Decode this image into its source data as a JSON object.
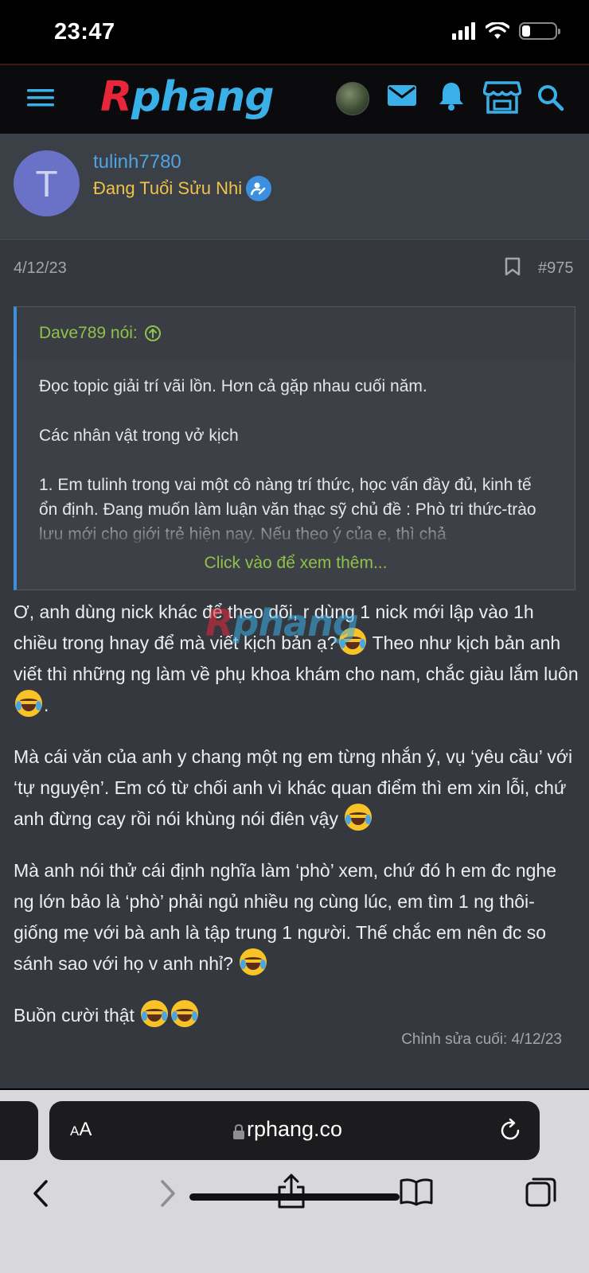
{
  "status": {
    "time": "23:47"
  },
  "header": {
    "logo_first": "R",
    "logo_rest": "phang",
    "icons": [
      "menu-icon",
      "mail-icon",
      "bell-icon",
      "store-icon",
      "search-icon"
    ]
  },
  "user": {
    "initial": "T",
    "name": "tulinh7780",
    "title": "Đang Tuổi Sửu Nhi"
  },
  "post": {
    "date": "4/12/23",
    "number": "#975",
    "quote": {
      "author": "Dave789 nói:",
      "paragraphs": [
        "Đọc topic giải trí vãi lồn. Hơn cả gặp nhau cuối năm.",
        "Các nhân vật trong vở kịch",
        "1. Em tulinh trong vai một cô nàng trí thức, học vấn đầy đủ, kinh tế ổn định. Đang muốn làm luận văn thạc sỹ chủ đề : Phò tri thức-trào lưu mới cho giới trẻ hiện nay. Nếu theo ý của e, thì chả"
      ],
      "more": "Click vào để xem thêm..."
    },
    "body": {
      "p1a": "Ơ, anh dùng nick khác để theo dõi, r dùng 1 nick mới lập vào 1h chiều trong hnay để mà viết kịch bản ạ?",
      "p1b": " Theo như kịch bản anh viết thì những ng làm về phụ khoa khám cho nam, chắc giàu lắm luôn",
      "p1c": ".",
      "p2": "Mà cái văn của anh y chang một ng em từng nhắn ý, vụ ‘yêu cầu’ với ‘tự nguyện’. Em có từ chối anh vì khác quan điểm thì em xin lỗi, chứ anh đừng cay rồi nói khùng nói điên vậy ",
      "p3": "Mà anh nói thử cái định nghĩa làm ‘phò’ xem, chứ đó h em đc nghe ng lớn bảo là ‘phò’ phải ngủ nhiều ng cùng lúc, em tìm 1 ng thôi- giống mẹ với bà anh là tập trung 1 người. Thế chắc em nên đc so sánh sao với họ v anh nhỉ? ",
      "p4": "Buồn cười thật "
    },
    "edited": "Chỉnh sửa cuối: 4/12/23"
  },
  "browser": {
    "aa_small": "A",
    "aa_large": "A",
    "url": "rphang.co",
    "toolbar": [
      "back-icon",
      "forward-icon",
      "share-icon",
      "bookmarks-icon",
      "tabs-icon"
    ]
  },
  "colors": {
    "accent": "#3d8fe0",
    "quote_green": "#8ec24a",
    "rank_gold": "#f0c24a"
  }
}
